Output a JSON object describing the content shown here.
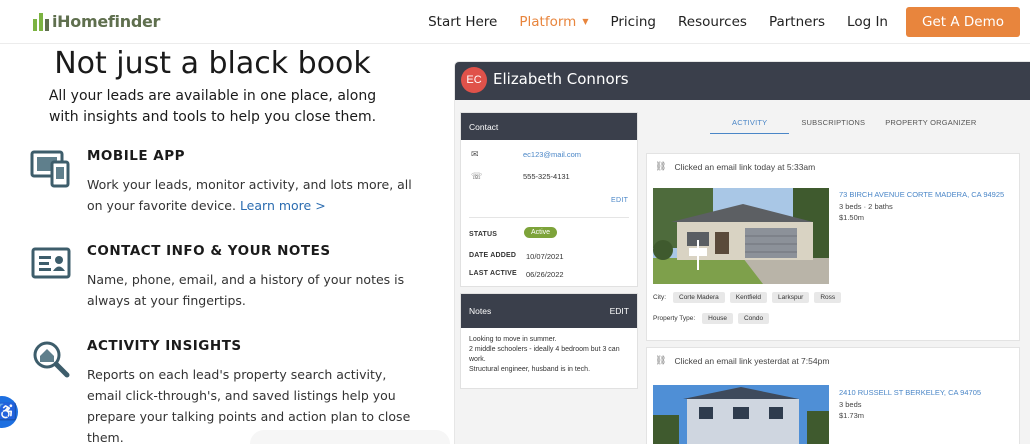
{
  "nav": {
    "logo_text": "iHomefinder",
    "links": [
      {
        "label": "Start Here",
        "active": false
      },
      {
        "label": "Platform",
        "active": true,
        "caret": "▼"
      },
      {
        "label": "Pricing",
        "active": false
      },
      {
        "label": "Resources",
        "active": false
      },
      {
        "label": "Partners",
        "active": false
      },
      {
        "label": "Log In",
        "active": false
      }
    ],
    "cta_label": "Get A Demo",
    "accent_color": "#e8853d"
  },
  "hero": {
    "title": "Not just a black book",
    "subtitle": "All your leads are available in one place, along with insights and tools to help you close them."
  },
  "features": [
    {
      "icon": "mobile-devices-icon",
      "title": "MOBILE APP",
      "text": "Work your leads, monitor activity, and lots more, all on your favorite device.",
      "link": "Learn more >"
    },
    {
      "icon": "contact-card-icon",
      "title": "CONTACT INFO & YOUR NOTES",
      "text": "Name, phone, email, and a history of your notes is always at your fingertips."
    },
    {
      "icon": "house-search-icon",
      "title": "ACTIVITY INSIGHTS",
      "text": "Reports on each lead's property search activity, email click-through's, and saved listings help you prepare your talking points and action plan to close them."
    }
  ],
  "app": {
    "avatar_initials": "EC",
    "lead_name": "Elizabeth Connors",
    "contact": {
      "header": "Contact",
      "email": "ec123@mail.com",
      "phone": "555-325-4131",
      "edit": "EDIT",
      "status_label": "STATUS",
      "status_value": "Active",
      "date_added_label": "DATE ADDED",
      "date_added": "10/07/2021",
      "last_active_label": "LAST ACTIVE",
      "last_active": "06/26/2022"
    },
    "notes": {
      "header": "Notes",
      "edit": "EDIT",
      "lines": [
        "Looking to move in summer.",
        "2 middle schoolers - ideally 4 bedroom but 3 can work.",
        "Structural engineer, husband is in tech."
      ]
    },
    "tabs": [
      "ACTIVITY",
      "SUBSCRIPTIONS",
      "PROPERTY ORGANIZER"
    ],
    "activities": [
      {
        "title": "Clicked an email link today at 5:33am",
        "address": "73 BIRCH AVENUE CORTE MADERA, CA 94925",
        "beds_baths": "3 beds · 2 baths",
        "price": "$1.50m",
        "city_label": "City:",
        "cities": [
          "Corte Madera",
          "Kentfield",
          "Larkspur",
          "Ross"
        ],
        "ptype_label": "Property Type:",
        "ptypes": [
          "House",
          "Condo"
        ]
      },
      {
        "title": "Clicked an email link yesterdat at 7:54pm",
        "address": "2410 RUSSELL ST BERKELEY, CA 94705",
        "beds_baths": "3 beds",
        "price": "$1.73m"
      }
    ]
  }
}
